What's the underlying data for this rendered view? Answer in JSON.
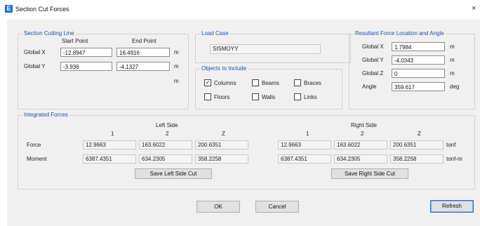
{
  "window": {
    "title": "Section Cut Forces",
    "icon_letter": "E",
    "close_glyph": "×"
  },
  "section_cutting_line": {
    "legend": "Section Cutting Line",
    "col_start": "Start Point",
    "col_end": "End Point",
    "rows": [
      {
        "label": "Global  X",
        "start": "-12.8947",
        "end": "16.4916",
        "unit": "m"
      },
      {
        "label": "Global  Y",
        "start": "-3.936",
        "end": "-4.1327",
        "unit": "m"
      }
    ],
    "extra_unit": "m"
  },
  "load_case": {
    "legend": "Load Case",
    "value": "SISMOYY"
  },
  "objects_to_include": {
    "legend": "Objects to Include",
    "columns": {
      "label": "Columns",
      "checked": true
    },
    "beams": {
      "label": "Beams",
      "checked": false
    },
    "braces": {
      "label": "Braces",
      "checked": false
    },
    "floors": {
      "label": "Floors",
      "checked": false
    },
    "walls": {
      "label": "Walls",
      "checked": false
    },
    "links": {
      "label": "Links",
      "checked": false
    }
  },
  "resultant": {
    "legend": "Resultant Force Location and Angle",
    "rows": [
      {
        "label": "Global  X",
        "value": "1.7984",
        "unit": "m"
      },
      {
        "label": "Global  Y",
        "value": "-4.0343",
        "unit": "m"
      },
      {
        "label": "Global  Z",
        "value": "0",
        "unit": "m"
      },
      {
        "label": "Angle",
        "value": "359.617",
        "unit": "deg"
      }
    ]
  },
  "integrated_forces": {
    "legend": "Integrated Forces",
    "left_title": "Left Side",
    "right_title": "Right Side",
    "col_headers": [
      "1",
      "2",
      "Z"
    ],
    "rows": [
      {
        "label": "Force",
        "left": [
          "12.9663",
          "163.6022",
          "200.6351"
        ],
        "right": [
          "12.9663",
          "163.6022",
          "200.6351"
        ],
        "unit": "tonf"
      },
      {
        "label": "Moment",
        "left": [
          "6387.4351",
          "634.2305",
          "358.2258"
        ],
        "right": [
          "6387.4351",
          "634.2305",
          "358.2258"
        ],
        "unit": "tonf-m"
      }
    ],
    "save_left": "Save Left Side Cut",
    "save_right": "Save Right Side Cut"
  },
  "footer": {
    "ok": "OK",
    "cancel": "Cancel",
    "refresh": "Refresh"
  }
}
